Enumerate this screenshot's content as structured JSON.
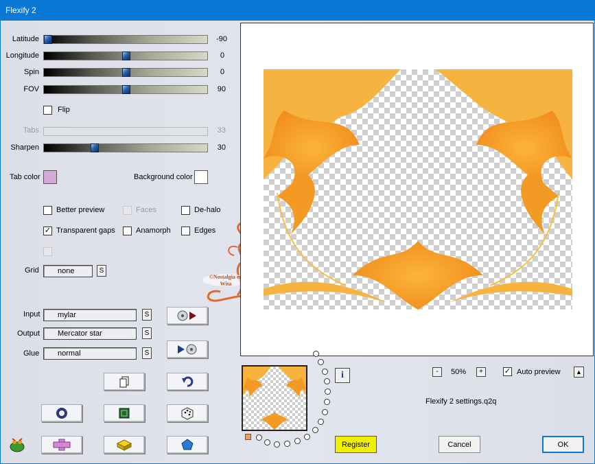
{
  "window": {
    "title": "Flexify 2"
  },
  "sliders": [
    {
      "label": "Latitude",
      "value": "-90",
      "level": 0.0
    },
    {
      "label": "Longitude",
      "value": "0",
      "level": 0.5
    },
    {
      "label": "Spin",
      "value": "0",
      "level": 0.5
    },
    {
      "label": "FOV",
      "value": "90",
      "level": 0.5
    }
  ],
  "flip": {
    "label": "Flip",
    "checked": false
  },
  "tabs": {
    "label": "Tabs",
    "value": "33"
  },
  "sharpen": {
    "label": "Sharpen",
    "value": "30",
    "level": 0.3
  },
  "colors": {
    "tab_label": "Tab color",
    "tab_color": "#d5a9d8",
    "bg_label": "Background color",
    "bg_color": "#ffffff"
  },
  "options": {
    "better_preview": {
      "label": "Better preview",
      "checked": false
    },
    "faces": {
      "label": "Faces",
      "checked": false
    },
    "de_halo": {
      "label": "De-halo",
      "checked": false
    },
    "transparent_gaps": {
      "label": "Transparent gaps",
      "checked": true
    },
    "anamorph": {
      "label": "Anamorph",
      "checked": false
    },
    "edges": {
      "label": "Edges",
      "checked": false
    }
  },
  "grid": {
    "label": "Grid",
    "value": "none",
    "s_label": "S"
  },
  "projection": {
    "input_label": "Input",
    "input_value": "mylar",
    "output_label": "Output",
    "output_value": "Mercator star",
    "glue_label": "Glue",
    "glue_value": "normal",
    "s_label": "S"
  },
  "zoom": {
    "minus": "-",
    "value": "50%",
    "plus": "+"
  },
  "auto_preview": {
    "label": "Auto preview",
    "checked": true,
    "arrow": "▲"
  },
  "settings_file": "Flexify 2 settings.q2q",
  "info_glyph": "i",
  "buttons": {
    "register": "Register",
    "cancel": "Cancel",
    "ok": "OK"
  },
  "watermark": "©Nostalgia en Wita",
  "icons": {
    "import": "disc-play-icon",
    "export": "play-disc-icon",
    "copy": "copy-pages-icon",
    "undo": "undo-arrow-icon",
    "ring": "ring-icon",
    "square": "green-square-icon",
    "dice": "dice-icon",
    "frog": "frog-logo-icon",
    "cross": "pink-cross-icon",
    "brick": "yellow-brick-icon",
    "gem": "blue-pentagon-icon"
  }
}
